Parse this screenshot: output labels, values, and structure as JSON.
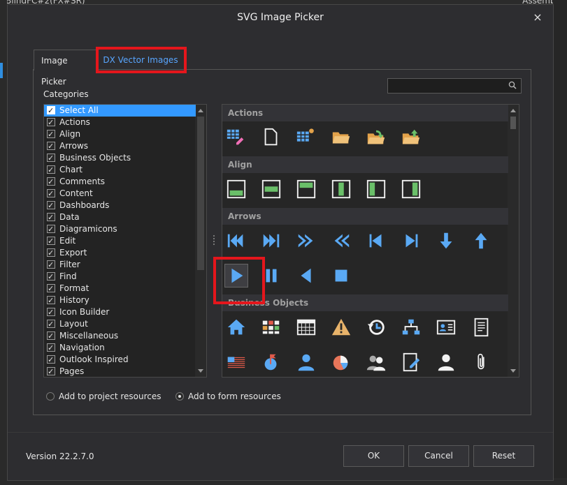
{
  "background": {
    "title_left": "BlindFC#2(FX#SR)",
    "title_right": "Assembly"
  },
  "dialog": {
    "title": "SVG Image Picker",
    "close_label": "×",
    "tabs": [
      {
        "label": "Image Picker"
      },
      {
        "label": "DX Vector Images"
      }
    ],
    "categories_label": "Categories",
    "search_placeholder": "",
    "categories": [
      {
        "label": "Select All",
        "checked": true
      },
      {
        "label": "Actions",
        "checked": true
      },
      {
        "label": "Align",
        "checked": true
      },
      {
        "label": "Arrows",
        "checked": true
      },
      {
        "label": "Business Objects",
        "checked": true
      },
      {
        "label": "Chart",
        "checked": true
      },
      {
        "label": "Comments",
        "checked": true
      },
      {
        "label": "Content",
        "checked": true
      },
      {
        "label": "Dashboards",
        "checked": true
      },
      {
        "label": "Data",
        "checked": true
      },
      {
        "label": "Diagramicons",
        "checked": true
      },
      {
        "label": "Edit",
        "checked": true
      },
      {
        "label": "Export",
        "checked": true
      },
      {
        "label": "Filter",
        "checked": true
      },
      {
        "label": "Find",
        "checked": true
      },
      {
        "label": "Format",
        "checked": true
      },
      {
        "label": "History",
        "checked": true
      },
      {
        "label": "Icon Builder",
        "checked": true
      },
      {
        "label": "Layout",
        "checked": true
      },
      {
        "label": "Miscellaneous",
        "checked": true
      },
      {
        "label": "Navigation",
        "checked": true
      },
      {
        "label": "Outlook Inspired",
        "checked": true
      },
      {
        "label": "Pages",
        "checked": true
      }
    ],
    "gallery": {
      "groups": [
        {
          "name": "Actions",
          "icons": [
            "grid-edit-icon",
            "new-document-icon",
            "grid-new-icon",
            "open-folder-icon",
            "open-folder-arrow-icon",
            "folder-upload-icon"
          ]
        },
        {
          "name": "Align",
          "icons": [
            "align-bottom-icon",
            "align-middle-icon",
            "align-top-icon",
            "align-left-icon",
            "align-center-icon",
            "align-right-icon"
          ]
        },
        {
          "name": "Arrows",
          "icons": [
            "first-icon",
            "last-skip-icon",
            "fast-forward-icon",
            "rewind-icon",
            "prev-icon",
            "next-icon",
            "arrow-down-icon",
            "arrow-up-icon",
            "play-icon",
            "pause-icon",
            "triangle-left-icon",
            "stop-icon"
          ]
        },
        {
          "name": "Business Objects",
          "icons": [
            "home-icon",
            "tiles-icon",
            "calendar-icon",
            "warning-icon",
            "history-icon",
            "org-chart-icon",
            "contact-card-icon",
            "document-icon",
            "flag-list-icon",
            "pin-icon",
            "user-icon",
            "pie-chart-icon",
            "users-icon",
            "edit-document-icon",
            "person-icon",
            "paperclip-icon"
          ]
        }
      ]
    },
    "radio_project": "Add to project resources",
    "radio_form": "Add to form resources",
    "version": "Version 22.2.7.0",
    "buttons": {
      "ok": "OK",
      "cancel": "Cancel",
      "reset": "Reset"
    },
    "colors": {
      "accent": "#58a6ff",
      "highlight": "#e4161c",
      "icon_blue": "#5aa9f4",
      "icon_orange": "#e3a24a",
      "icon_green": "#6abf69"
    }
  }
}
